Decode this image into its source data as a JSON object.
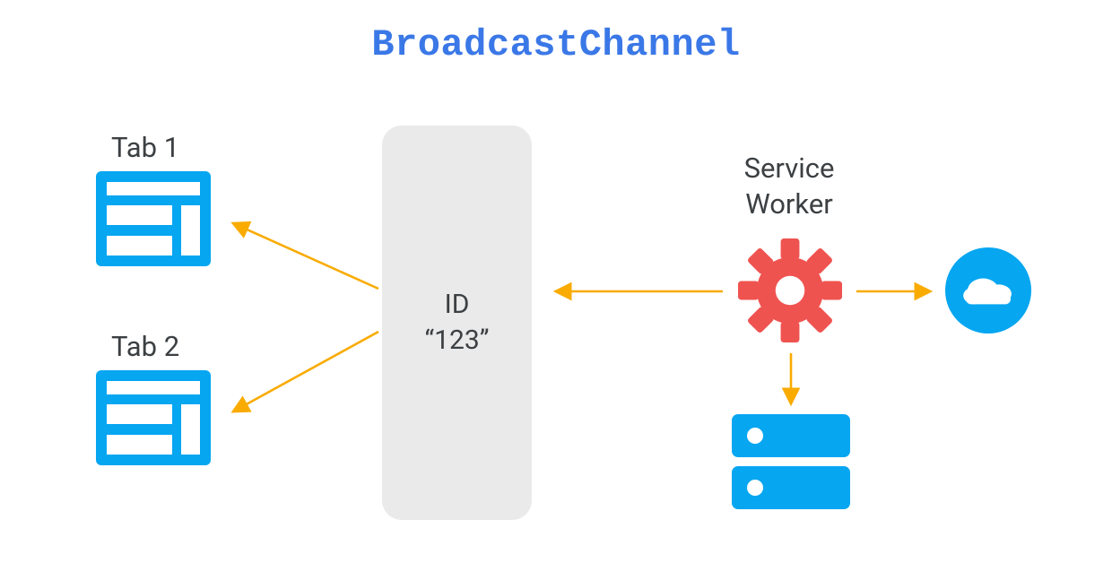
{
  "title": "BroadcastChannel",
  "tabs": [
    {
      "label": "Tab 1"
    },
    {
      "label": "Tab 2"
    }
  ],
  "channel": {
    "label_line1": "ID",
    "label_line2": "“123”"
  },
  "service_worker": {
    "label_line1": "Service",
    "label_line2": "Worker"
  },
  "icons": {
    "tab": "tab-window-icon",
    "gear": "gear-icon",
    "cloud": "cloud-icon",
    "storage": "storage-server-icon"
  },
  "colors": {
    "title": "#3b78e7",
    "accent_blue": "#06a6f1",
    "accent_red": "#ef5350",
    "arrow": "#f9ab00",
    "channel_bg": "#eaeaea",
    "text": "#3c4043"
  },
  "arrows": [
    {
      "from": "channel",
      "to": "tab-1"
    },
    {
      "from": "channel",
      "to": "tab-2"
    },
    {
      "from": "service-worker",
      "to": "channel"
    },
    {
      "from": "service-worker",
      "to": "cloud"
    },
    {
      "from": "service-worker",
      "to": "storage"
    }
  ]
}
